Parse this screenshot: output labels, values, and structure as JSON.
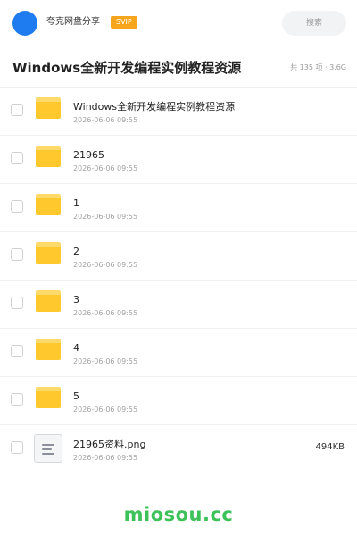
{
  "header": {
    "app_name": "夸克网盘分享",
    "badge": "SVIP",
    "search_placeholder": "搜索"
  },
  "page": {
    "title": "Windows全新开发编程实例教程资源",
    "meta": "共 135 项 · 3.6G"
  },
  "files": [
    {
      "name": "Windows全新开发编程实例教程资源",
      "date": "2026-06-06 09:55",
      "type": "folder",
      "size": ""
    },
    {
      "name": "21965",
      "date": "2026-06-06 09:55",
      "type": "folder",
      "size": ""
    },
    {
      "name": "1",
      "date": "2026-06-06 09:55",
      "type": "folder",
      "size": ""
    },
    {
      "name": "2",
      "date": "2026-06-06 09:55",
      "type": "folder",
      "size": ""
    },
    {
      "name": "3",
      "date": "2026-06-06 09:55",
      "type": "folder",
      "size": ""
    },
    {
      "name": "4",
      "date": "2026-06-06 09:55",
      "type": "folder",
      "size": ""
    },
    {
      "name": "5",
      "date": "2026-06-06 09:55",
      "type": "folder",
      "size": ""
    },
    {
      "name": "21965资料.png",
      "date": "2026-06-06 09:55",
      "type": "file",
      "size": "494KB"
    }
  ],
  "footer": {
    "watermark": "miosou.cc"
  },
  "colors": {
    "avatar": "#1e7cf0",
    "badge": "#f7a51c",
    "folder": "#ffc82c",
    "watermark": "#3dc25a"
  },
  "icons": {
    "folder": "folder-icon",
    "file": "document-icon"
  }
}
